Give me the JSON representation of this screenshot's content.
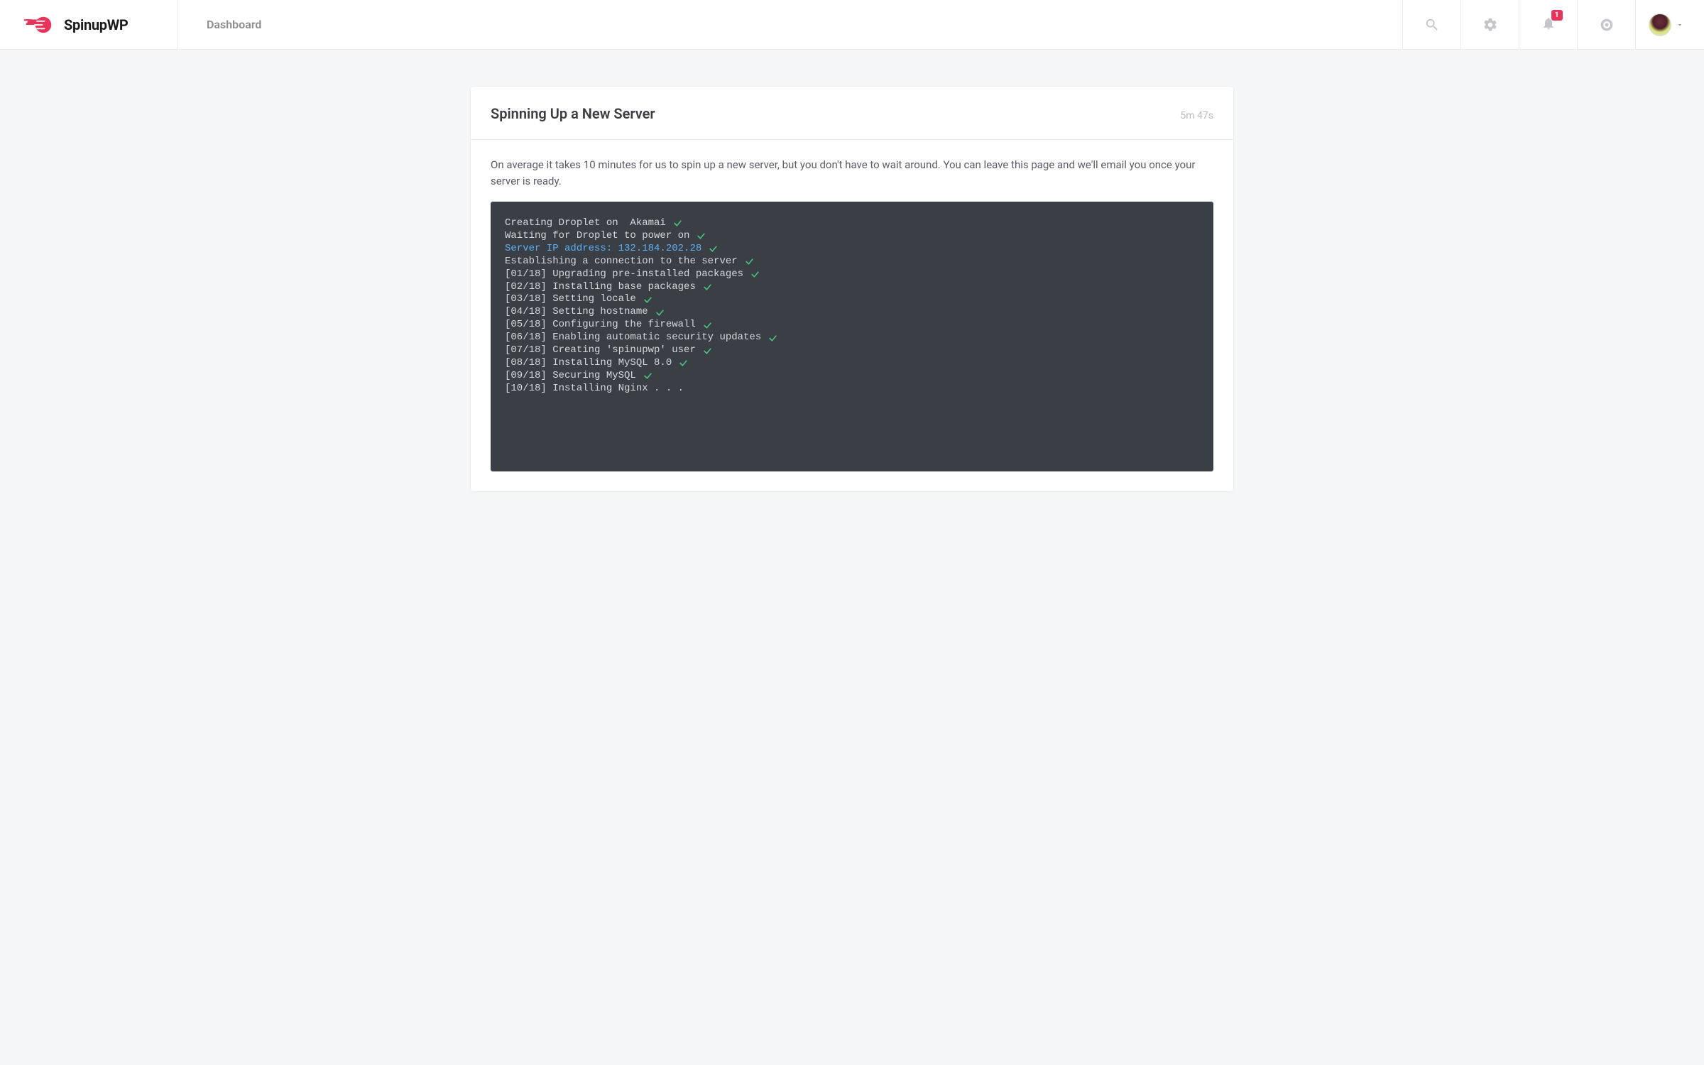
{
  "brand": {
    "name": "SpinupWP"
  },
  "nav": {
    "dashboard": "Dashboard"
  },
  "notifications": {
    "count": "1"
  },
  "card": {
    "title": "Spinning Up a New Server",
    "elapsed": "5m 47s"
  },
  "helper": "On average it takes 10 minutes for us to spin up a new server, but you don't have to wait around. You can leave this page and we'll email you once your server is ready.",
  "terminal": {
    "lines": [
      {
        "text": "Creating Droplet on  Akamai",
        "done": true,
        "link": false
      },
      {
        "text": "Waiting for Droplet to power on",
        "done": true,
        "link": false
      },
      {
        "text": "Server IP address: 132.184.202.28",
        "done": true,
        "link": true
      },
      {
        "text": "Establishing a connection to the server",
        "done": true,
        "link": false
      },
      {
        "text": "[01/18] Upgrading pre-installed packages",
        "done": true,
        "link": false
      },
      {
        "text": "[02/18] Installing base packages",
        "done": true,
        "link": false
      },
      {
        "text": "[03/18] Setting locale",
        "done": true,
        "link": false
      },
      {
        "text": "[04/18] Setting hostname",
        "done": true,
        "link": false
      },
      {
        "text": "[05/18] Configuring the firewall",
        "done": true,
        "link": false
      },
      {
        "text": "[06/18] Enabling automatic security updates",
        "done": true,
        "link": false
      },
      {
        "text": "[07/18] Creating 'spinupwp' user",
        "done": true,
        "link": false
      },
      {
        "text": "[08/18] Installing MySQL 8.0",
        "done": true,
        "link": false
      },
      {
        "text": "[09/18] Securing MySQL",
        "done": true,
        "link": false
      },
      {
        "text": "[10/18] Installing Nginx . . .",
        "done": false,
        "link": false
      }
    ]
  }
}
